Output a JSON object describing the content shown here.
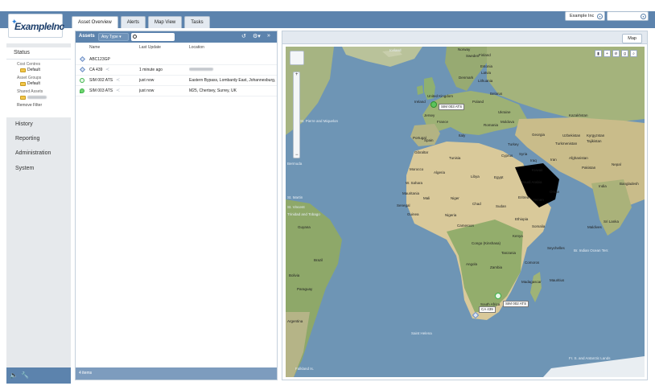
{
  "brand": {
    "logo_text": "ExampleInc"
  },
  "tabs": [
    "Asset Overview",
    "Alerts",
    "Map View",
    "Tasks"
  ],
  "org_select": "Example Inc",
  "sidebar": {
    "status_title": "Status",
    "cost_centres_label": "Cost Centres",
    "cost_centres_value": "Default",
    "asset_groups_label": "Asset Groups",
    "asset_groups_value": "Default",
    "shared_assets_label": "Shared Assets",
    "remove_filter": "Remove Filter",
    "nav": [
      "History",
      "Reporting",
      "Administration",
      "System"
    ]
  },
  "assets": {
    "title": "Assets",
    "type_filter": "Any Type",
    "columns": [
      "Name",
      "Last Update",
      "Location"
    ],
    "rows": [
      {
        "name": "ABC123GP",
        "update": "",
        "location": ""
      },
      {
        "name": "CA 439",
        "update": "1 minute ago",
        "location": ""
      },
      {
        "name": "SIM 002 ATS",
        "update": "just now",
        "location": "Eastern Bypass, Lombardy East, Johannesburg,"
      },
      {
        "name": "SIM 003 ATS",
        "update": "just now",
        "location": "M25, Chertsey, Surrey, UK"
      }
    ],
    "footer": "4 items"
  },
  "map": {
    "tab": "Map",
    "markers": {
      "uk": "SIM 003 ATS",
      "sa1": "SIM 002 ATS",
      "sa2": "CA 439"
    },
    "labels": {
      "iceland": "Iceland",
      "norway": "Norway",
      "sweden": "Sweden",
      "finland": "Finland",
      "estonia": "Estonia",
      "latvia": "Latvia",
      "lithuania": "Lithuania",
      "denmark": "Denmark",
      "uk": "United Kingdom",
      "ireland": "Ireland",
      "poland": "Poland",
      "belarus": "Belarus",
      "jersey": "Jersey",
      "france": "France",
      "ukraine": "Ukraine",
      "moldova": "Moldova",
      "romania": "Romania",
      "kazakhstan": "Kazakhstan",
      "spm": "St. Pierre and Miquelon",
      "spain": "Spain",
      "portugal": "Portugal",
      "italy": "Italy",
      "turkey": "Turkey",
      "georgia": "Georgia",
      "uzbekistan": "Uzbekistan",
      "kyrgyzstan": "Kyrgyzstan",
      "turkmenistan": "Turkmenistan",
      "tajikistan": "Tajikistan",
      "bermuda": "Bermuda",
      "gibraltar": "Gibraltar",
      "tunisia": "Tunisia",
      "cyprus": "Cyprus",
      "syria": "Syria",
      "iraq": "Iraq",
      "iran": "Iran",
      "afghanistan": "Afghanistan",
      "pakistan": "Pakistan",
      "morocco": "Morocco",
      "algeria": "Algeria",
      "libya": "Libya",
      "egypt": "Egypt",
      "kuwait": "Kuwait",
      "nepal": "Nepal",
      "wsahara": "W. Sahara",
      "saudi": "Saudi Arabia",
      "oman": "Oman",
      "india": "India",
      "bangladesh": "Bangladesh",
      "mauritania": "Mauritania",
      "mali": "Mali",
      "niger": "Niger",
      "stmartin": "St. Martin",
      "senegal": "Senegal",
      "chad": "Chad",
      "sudan": "Sudan",
      "eritrea": "Eritrea",
      "yemen": "Yemen",
      "stvincent": "St. Vincent",
      "guinea": "Guinea",
      "nigeria": "Nigeria",
      "ethiopia": "Ethiopia",
      "trinidad": "Trinidad and Tobago",
      "guyana": "Guyana",
      "srilanka": "Sri Lanka",
      "cameroon": "Cameroon",
      "somalia": "Somalia",
      "kenya": "Kenya",
      "maldives": "Maldives",
      "congo": "Congo (Kinshasa)",
      "seychelles": "Seychelles",
      "tanzania": "Tanzania",
      "brit_indian": "Br. Indian Ocean Terr.",
      "brazil": "Brazil",
      "angola": "Angola",
      "zambia": "Zambia",
      "comoros": "Comoros",
      "bolivia": "Bolivia",
      "madagascar": "Madagascar",
      "mauritius": "Mauritius",
      "paraguay": "Paraguay",
      "south_africa": "South Africa",
      "argentina": "Argentina",
      "st_helena": "Saint Helena",
      "falkland": "Falkland Is.",
      "fr_s_antarctic": "Fr. S. and Antarctic Lands",
      "heard": "Heard I. and McDonald"
    }
  },
  "colors": {
    "primary": "#5c83ad",
    "ocean": "#6e95b5",
    "land": "#a7b681",
    "desert": "#d9c99a"
  }
}
